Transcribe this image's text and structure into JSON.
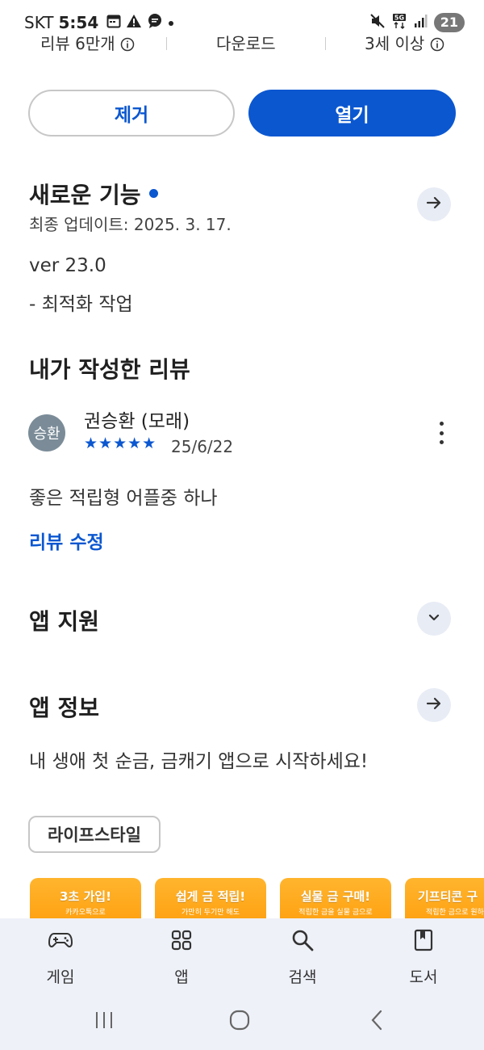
{
  "status_bar": {
    "carrier": "SKT",
    "time": "5:54",
    "battery": "21"
  },
  "stats": {
    "reviews": "리뷰 6만개",
    "downloads": "다운로드",
    "rating_age": "3세 이상"
  },
  "actions": {
    "uninstall_label": "제거",
    "open_label": "열기"
  },
  "whats_new": {
    "title": "새로운 기능",
    "updated": "최종 업데이트: 2025. 3. 17.",
    "version": "ver 23.0",
    "note": "- 최적화 작업"
  },
  "my_review": {
    "title": "내가 작성한 리뷰",
    "avatar_text": "승환",
    "reviewer": "권승환 (모래)",
    "stars": "★★★★★",
    "rating": 5,
    "date": "25/6/22",
    "text": "좋은 적립형 어플중 하나",
    "edit_label": "리뷰 수정"
  },
  "app_support": {
    "title": "앱 지원"
  },
  "app_info": {
    "title": "앱 정보",
    "description": "내 생애 첫 순금, 금캐기 앱으로 시작하세요!",
    "category": "라이프스타일"
  },
  "screenshots": [
    {
      "title": "3초 가입!",
      "sub": "카카오톡으로"
    },
    {
      "title": "쉽게 금 적립!",
      "sub": "가만히 두기만 해도"
    },
    {
      "title": "실물 금 구매!",
      "sub": "적립한 금을 실물 금으로"
    },
    {
      "title": "기프티콘 구",
      "sub": "적립한 금으로 원하"
    }
  ],
  "bottom_nav": [
    {
      "label": "게임",
      "icon": "gamepad-icon"
    },
    {
      "label": "앱",
      "icon": "apps-grid-icon"
    },
    {
      "label": "검색",
      "icon": "search-icon"
    },
    {
      "label": "도서",
      "icon": "book-icon"
    }
  ],
  "colors": {
    "accent": "#0b57d0",
    "chip_bg": "#e8ecf5",
    "nav_bg": "#eef1f8",
    "screenshot_orange": "#ffa81f"
  }
}
